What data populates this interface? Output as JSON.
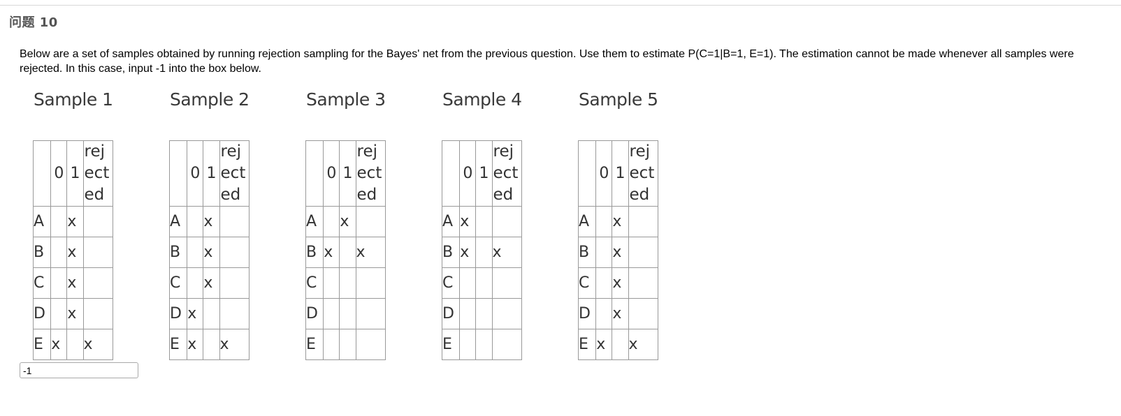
{
  "question": {
    "title": "问题 10",
    "text": "Below are a set of samples obtained by running rejection sampling for the Bayes' net from the previous question. Use them to estimate P(C=1|B=1, E=1). The estimation cannot be made whenever all samples were rejected. In this case, input -1 into the box below."
  },
  "table_header": {
    "col_0": "0",
    "col_1": "1",
    "col_rejected": "rejected"
  },
  "samples": [
    {
      "title": "Sample 1",
      "rows": [
        {
          "label": "A",
          "c0": "",
          "c1": "x",
          "rej": ""
        },
        {
          "label": "B",
          "c0": "",
          "c1": "x",
          "rej": ""
        },
        {
          "label": "C",
          "c0": "",
          "c1": "x",
          "rej": ""
        },
        {
          "label": "D",
          "c0": "",
          "c1": "x",
          "rej": ""
        },
        {
          "label": "E",
          "c0": "x",
          "c1": "",
          "rej": "x"
        }
      ]
    },
    {
      "title": "Sample 2",
      "rows": [
        {
          "label": "A",
          "c0": "",
          "c1": "x",
          "rej": ""
        },
        {
          "label": "B",
          "c0": "",
          "c1": "x",
          "rej": ""
        },
        {
          "label": "C",
          "c0": "",
          "c1": "x",
          "rej": ""
        },
        {
          "label": "D",
          "c0": "x",
          "c1": "",
          "rej": ""
        },
        {
          "label": "E",
          "c0": "x",
          "c1": "",
          "rej": "x"
        }
      ]
    },
    {
      "title": "Sample 3",
      "rows": [
        {
          "label": "A",
          "c0": "",
          "c1": "x",
          "rej": ""
        },
        {
          "label": "B",
          "c0": "x",
          "c1": "",
          "rej": "x"
        },
        {
          "label": "C",
          "c0": "",
          "c1": "",
          "rej": ""
        },
        {
          "label": "D",
          "c0": "",
          "c1": "",
          "rej": ""
        },
        {
          "label": "E",
          "c0": "",
          "c1": "",
          "rej": ""
        }
      ]
    },
    {
      "title": "Sample 4",
      "rows": [
        {
          "label": "A",
          "c0": "x",
          "c1": "",
          "rej": ""
        },
        {
          "label": "B",
          "c0": "x",
          "c1": "",
          "rej": "x"
        },
        {
          "label": "C",
          "c0": "",
          "c1": "",
          "rej": ""
        },
        {
          "label": "D",
          "c0": "",
          "c1": "",
          "rej": ""
        },
        {
          "label": "E",
          "c0": "",
          "c1": "",
          "rej": ""
        }
      ]
    },
    {
      "title": "Sample 5",
      "rows": [
        {
          "label": "A",
          "c0": "",
          "c1": "x",
          "rej": ""
        },
        {
          "label": "B",
          "c0": "",
          "c1": "x",
          "rej": ""
        },
        {
          "label": "C",
          "c0": "",
          "c1": "x",
          "rej": ""
        },
        {
          "label": "D",
          "c0": "",
          "c1": "x",
          "rej": ""
        },
        {
          "label": "E",
          "c0": "x",
          "c1": "",
          "rej": "x"
        }
      ]
    }
  ],
  "answer": {
    "value": "-1"
  }
}
